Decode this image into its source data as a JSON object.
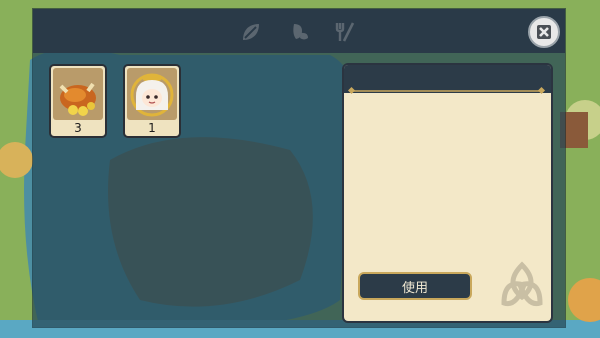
{
  "tabs": [
    {
      "icon": "leaf-icon"
    },
    {
      "icon": "seed-icon"
    },
    {
      "icon": "utensils-icon"
    }
  ],
  "close_icon": "close-x-icon",
  "inventory": [
    {
      "name": "roast-chicken",
      "icon": "roast-chicken-icon",
      "count": "3"
    },
    {
      "name": "character-doll",
      "icon": "character-portrait-icon",
      "count": "1"
    }
  ],
  "detail": {
    "title": "",
    "use_button": "使用",
    "emblem_icon": "triquetra-emblem-icon"
  },
  "colors": {
    "panel_bar": "#2a3a48",
    "card_bg": "#f3e8c8",
    "button_border": "#c9a85c"
  }
}
